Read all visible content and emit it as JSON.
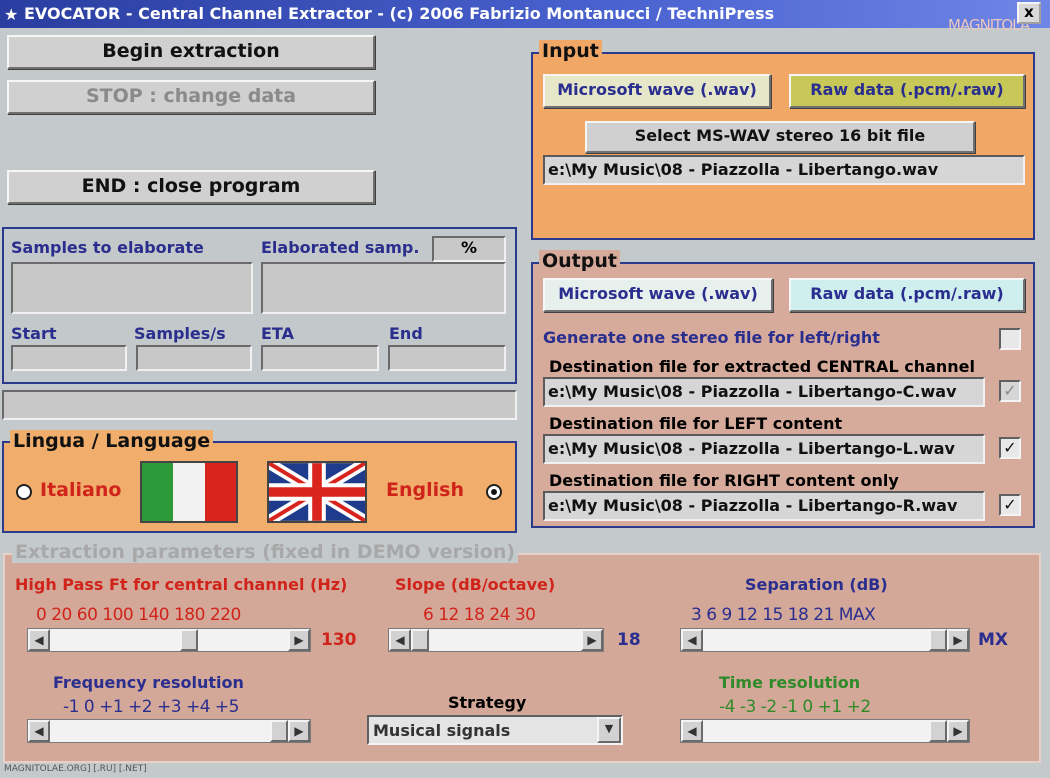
{
  "window": {
    "title": "EVOCATOR - Central Channel Extractor - (c) 2006 Fabrizio Montanucci / TechniPress",
    "close": "x",
    "watermark": "MAGNITOLA"
  },
  "buttons": {
    "begin": "Begin extraction",
    "stop": "STOP : change data",
    "end": "END : close program"
  },
  "progress": {
    "samples_to_elaborate": "Samples to elaborate",
    "elaborated": "Elaborated samp.",
    "percent": "%",
    "start": "Start",
    "samples_per_s": "Samples/s",
    "eta": "ETA",
    "end": "End"
  },
  "language": {
    "legend": "Lingua / Language",
    "italiano": "Italiano",
    "english": "English",
    "selected": "English"
  },
  "input": {
    "legend": "Input",
    "wav": "Microsoft wave (.wav)",
    "raw": "Raw data (.pcm/.raw)",
    "select": "Select MS-WAV stereo 16 bit file",
    "path": "e:\\My Music\\08 - Piazzolla - Libertango.wav"
  },
  "output": {
    "legend": "Output",
    "wav": "Microsoft wave (.wav)",
    "raw": "Raw data (.pcm/.raw)",
    "stereo_label": "Generate one stereo file for left/right",
    "stereo_checked": "",
    "central_label": "Destination file for extracted CENTRAL channel",
    "central_path": "e:\\My Music\\08 - Piazzolla - Libertango-C.wav",
    "central_checked": "✓",
    "left_label": "Destination file for LEFT content",
    "left_path": "e:\\My Music\\08 - Piazzolla - Libertango-L.wav",
    "left_checked": "✓",
    "right_label": "Destination file for RIGHT content only",
    "right_path": "e:\\My Music\\08 - Piazzolla - Libertango-R.wav",
    "right_checked": "✓"
  },
  "params": {
    "legend": "Extraction parameters (fixed in DEMO version)",
    "highpass": {
      "label": "High Pass Ft for central channel (Hz)",
      "ticks": "0 20  60  100 140 180  220",
      "value": "130",
      "level": 0.59
    },
    "slope": {
      "label": "Slope (dB/octave)",
      "ticks": "6  12  18  24  30",
      "value": "18",
      "level": 0.0
    },
    "separation": {
      "label": "Separation (dB)",
      "ticks": "3   6   9  12  15  18  21     MAX",
      "value": "MX",
      "level": 1.0
    },
    "freqres": {
      "label": "Frequency resolution",
      "ticks": "-1   0   +1  +2  +3  +4  +5",
      "level": 1.0
    },
    "strategy": {
      "label": "Strategy",
      "value": "Musical signals"
    },
    "timeres": {
      "label": "Time resolution",
      "ticks": "-4  -3  -2  -1   0   +1  +2",
      "level": 1.0
    }
  },
  "footer": "MAGNITOLAE.ORG] [.RU] [.NET]",
  "colors": {
    "input_bg": "#f1a766",
    "output_bg": "#d7ab9b",
    "params_bg": "#d4a898",
    "lang_bg": "#f0ad6c",
    "titlebar": "#3a52c0"
  }
}
